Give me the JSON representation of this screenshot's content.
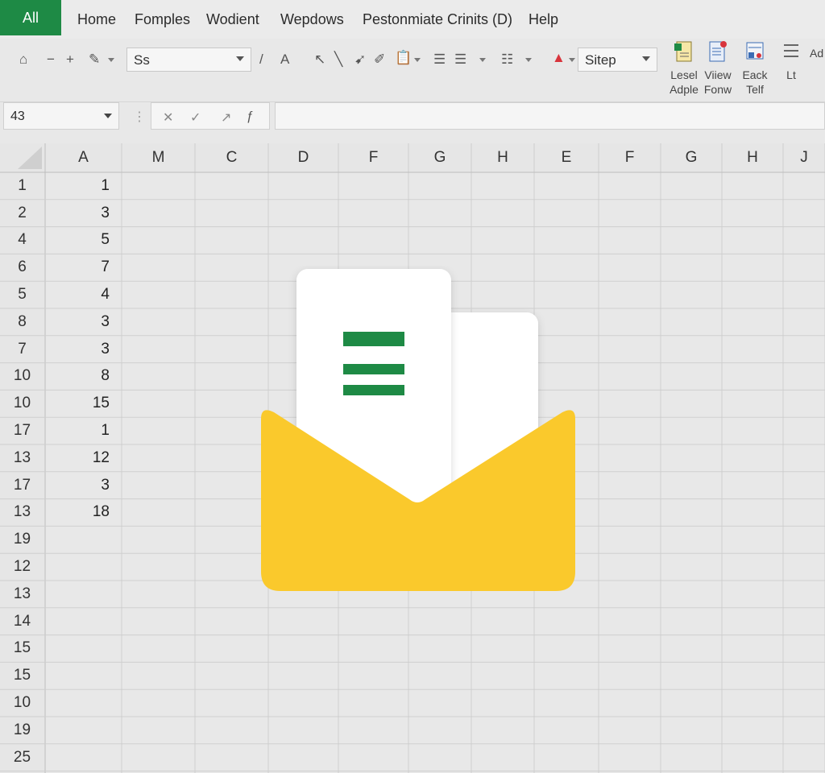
{
  "menu": {
    "active_tab": "All",
    "tabs": [
      "Home",
      "Fomples",
      "Wodient",
      "Wepdows",
      "Pestonmiate Crinits (D)",
      "Help"
    ]
  },
  "ribbon": {
    "font_box": "Ss",
    "style_box": "Sitep",
    "buttons": [
      {
        "line1": "Lesel",
        "line2": "Adple"
      },
      {
        "line1": "Viiew",
        "line2": "Fonw"
      },
      {
        "line1": "Eack",
        "line2": "Telf"
      },
      {
        "line1": "Lt",
        "line2": ""
      }
    ],
    "overflow_label": "Ad"
  },
  "formula_bar": {
    "name_box": "43",
    "formula": ""
  },
  "grid": {
    "columns": [
      "A",
      "M",
      "C",
      "D",
      "F",
      "G",
      "H",
      "E",
      "F",
      "G",
      "H",
      "J"
    ],
    "row_headers": [
      "1",
      "2",
      "4",
      "6",
      "5",
      "8",
      "7",
      "10",
      "10",
      "17",
      "13",
      "17",
      "13",
      "19",
      "12",
      "13",
      "14",
      "15",
      "15",
      "10",
      "19",
      "25"
    ],
    "col_a_values": [
      "1",
      "3",
      "5",
      "7",
      "4",
      "3",
      "3",
      "8",
      "15",
      "1",
      "12",
      "3",
      "18"
    ]
  },
  "colors": {
    "accent_green": "#1e8a45",
    "envelope_yellow": "#fac92c",
    "grid_line": "#cfcfcf"
  }
}
